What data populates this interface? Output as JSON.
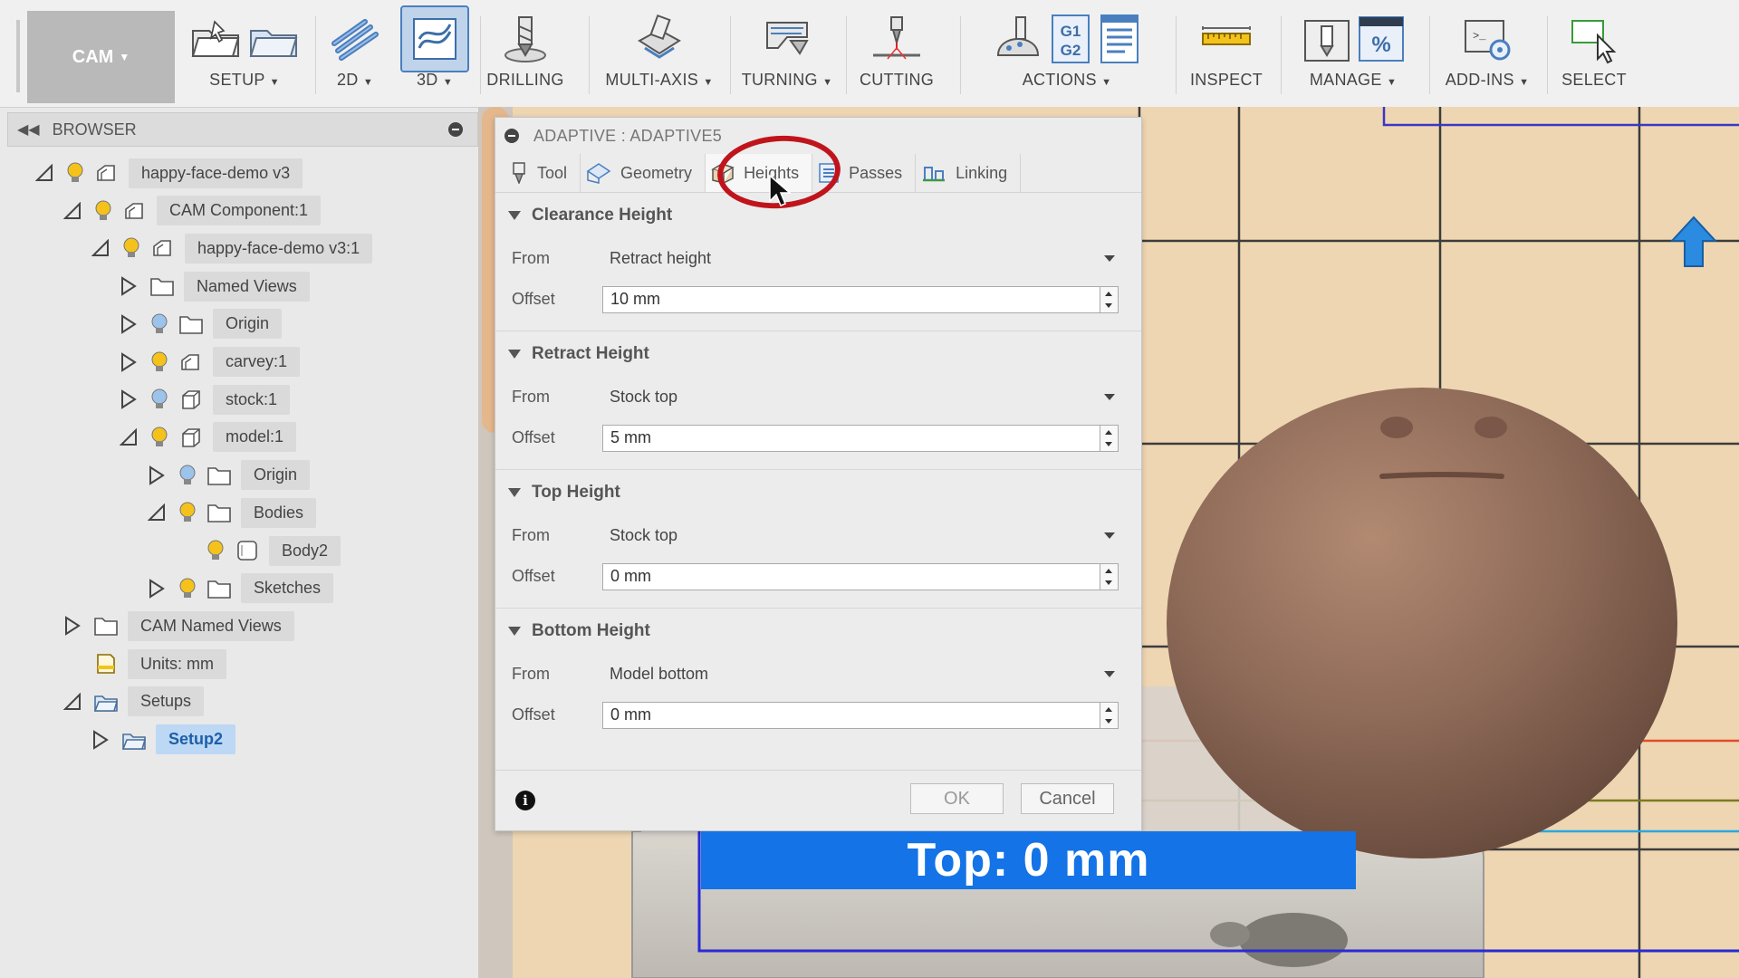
{
  "toolbar": {
    "workspace": "CAM",
    "groups": [
      {
        "label": "SETUP",
        "dropdown": true
      },
      {
        "label": "2D",
        "dropdown": true
      },
      {
        "label": "3D",
        "dropdown": true
      },
      {
        "label": "DRILLING",
        "dropdown": false
      },
      {
        "label": "MULTI-AXIS",
        "dropdown": true
      },
      {
        "label": "TURNING",
        "dropdown": true
      },
      {
        "label": "CUTTING",
        "dropdown": false
      },
      {
        "label": "ACTIONS",
        "dropdown": true
      },
      {
        "label": "INSPECT",
        "dropdown": false
      },
      {
        "label": "MANAGE",
        "dropdown": true
      },
      {
        "label": "ADD-INS",
        "dropdown": true
      },
      {
        "label": "SELECT",
        "dropdown": false
      }
    ],
    "icon_texts": {
      "g1": "G1",
      "g2": "G2",
      "percent": "%"
    }
  },
  "browser": {
    "title": "BROWSER",
    "tree": [
      {
        "label": "happy-face-demo v3",
        "level": 0,
        "toggle": "expanded",
        "bulb": "yellow",
        "icon": "component-icon"
      },
      {
        "label": "CAM Component:1",
        "level": 1,
        "toggle": "expanded",
        "bulb": "yellow",
        "icon": "component-icon"
      },
      {
        "label": "happy-face-demo v3:1",
        "level": 2,
        "toggle": "expanded",
        "bulb": "yellow",
        "icon": "component-icon"
      },
      {
        "label": "Named Views",
        "level": 3,
        "toggle": "collapsed",
        "bulb": "none",
        "icon": "folder-icon"
      },
      {
        "label": "Origin",
        "level": 3,
        "toggle": "collapsed",
        "bulb": "blue",
        "icon": "folder-icon"
      },
      {
        "label": "carvey:1",
        "level": 3,
        "toggle": "collapsed",
        "bulb": "yellow",
        "icon": "component-icon"
      },
      {
        "label": "stock:1",
        "level": 3,
        "toggle": "collapsed",
        "bulb": "blue",
        "icon": "box-icon"
      },
      {
        "label": "model:1",
        "level": 3,
        "toggle": "expanded",
        "bulb": "yellow",
        "icon": "box-icon"
      },
      {
        "label": "Origin",
        "level": 4,
        "toggle": "collapsed",
        "bulb": "blue",
        "icon": "folder-icon"
      },
      {
        "label": "Bodies",
        "level": 4,
        "toggle": "expanded",
        "bulb": "yellow",
        "icon": "folder-icon"
      },
      {
        "label": "Body2",
        "level": 5,
        "toggle": "none",
        "bulb": "yellow",
        "icon": "body-icon"
      },
      {
        "label": "Sketches",
        "level": 4,
        "toggle": "collapsed",
        "bulb": "yellow",
        "icon": "folder-icon"
      },
      {
        "label": "CAM Named Views",
        "level": 1,
        "toggle": "collapsed",
        "bulb": "none",
        "icon": "folder-icon"
      },
      {
        "label": "Units: mm",
        "level": 1,
        "toggle": "none",
        "bulb": "none",
        "icon": "document-icon"
      },
      {
        "label": "Setups",
        "level": 1,
        "toggle": "expanded",
        "bulb": "none",
        "icon": "setup-folder-icon"
      },
      {
        "label": "Setup2",
        "level": 2,
        "toggle": "collapsed",
        "bulb": "none",
        "icon": "setup-folder-icon",
        "selected": true
      }
    ]
  },
  "dialog": {
    "title": "ADAPTIVE : ADAPTIVE5",
    "tabs": [
      {
        "label": "Tool",
        "icon": "tool-icon",
        "active": false
      },
      {
        "label": "Geometry",
        "icon": "geometry-icon",
        "active": false
      },
      {
        "label": "Heights",
        "icon": "heights-icon",
        "active": true
      },
      {
        "label": "Passes",
        "icon": "passes-icon",
        "active": false
      },
      {
        "label": "Linking",
        "icon": "linking-icon",
        "active": false
      }
    ],
    "sections": [
      {
        "title": "Clearance Height",
        "from_label": "From",
        "from_value": "Retract height",
        "offset_label": "Offset",
        "offset_value": "10 mm"
      },
      {
        "title": "Retract Height",
        "from_label": "From",
        "from_value": "Stock top",
        "offset_label": "Offset",
        "offset_value": "5 mm"
      },
      {
        "title": "Top Height",
        "from_label": "From",
        "from_value": "Stock top",
        "offset_label": "Offset",
        "offset_value": "0 mm"
      },
      {
        "title": "Bottom Height",
        "from_label": "From",
        "from_value": "Model bottom",
        "offset_label": "Offset",
        "offset_value": "0 mm"
      }
    ],
    "info_glyph": "i",
    "ok_label": "OK",
    "cancel_label": "Cancel"
  },
  "banner": {
    "text": "Top: 0 mm"
  },
  "colors": {
    "accent_blue": "#1473e6",
    "annotation_red": "#c0141c",
    "selected_item": "#bcd8f5",
    "viewport_bg": "#eed6b2",
    "bulb_yellow": "#f4c21a",
    "bulb_blue": "#9cc3ea"
  }
}
